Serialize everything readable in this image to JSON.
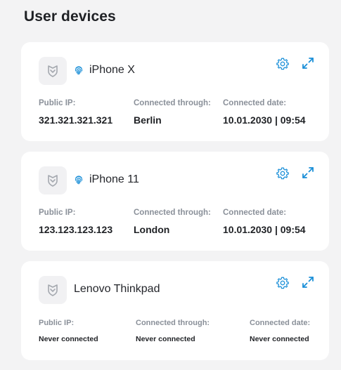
{
  "page": {
    "title": "User devices"
  },
  "labels": {
    "public_ip": "Public IP:",
    "connected_through": "Connected through:",
    "connected_date": "Connected date:"
  },
  "colors": {
    "accent": "#1a8fd8",
    "background": "#f3f3f4",
    "card": "#ffffff",
    "label": "#8a9099"
  },
  "devices": [
    {
      "name": "iPhone X",
      "biometric": true,
      "public_ip": "321.321.321.321",
      "connected_through": "Berlin",
      "connected_date": "10.01.2030 | 09:54"
    },
    {
      "name": "iPhone 11",
      "biometric": true,
      "public_ip": "123.123.123.123",
      "connected_through": "London",
      "connected_date": "10.01.2030 | 09:54"
    },
    {
      "name": "Lenovo Thinkpad",
      "biometric": false,
      "public_ip": "Never connected",
      "connected_through": "Never connected",
      "connected_date": "Never connected"
    }
  ],
  "icons": {
    "device": "shield-logo-icon",
    "fingerprint": "fingerprint-icon",
    "settings": "gear-icon",
    "expand": "expand-icon"
  }
}
